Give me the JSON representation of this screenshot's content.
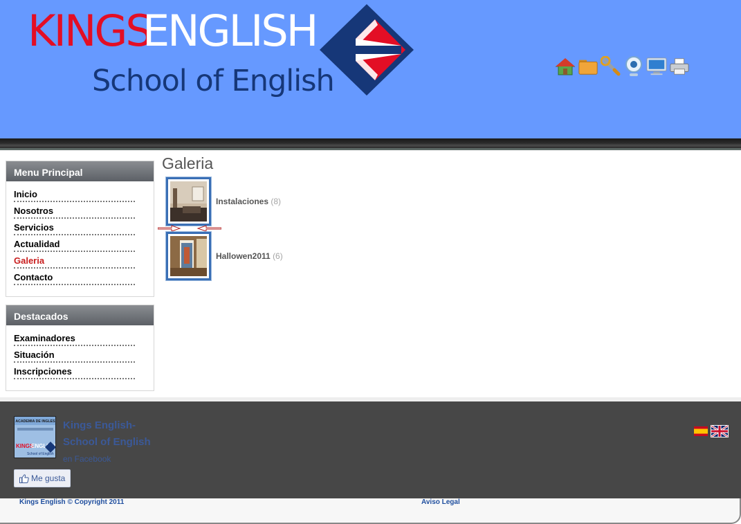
{
  "header": {
    "brand_kings": "KINGS",
    "brand_english": "ENGLISH",
    "brand_subtitle": "School of English",
    "icons": [
      "home-icon",
      "folder-icon",
      "wrench-icon",
      "webcam-icon",
      "monitor-icon",
      "printer-icon"
    ],
    "colors": {
      "header_bg": "#6699ff",
      "brand_red": "#e30e25",
      "brand_navy": "#163778"
    }
  },
  "sidebar": {
    "menu_title": "Menu Principal",
    "menu_items": [
      {
        "label": "Inicio"
      },
      {
        "label": "Nosotros"
      },
      {
        "label": "Servicios"
      },
      {
        "label": "Actualidad"
      },
      {
        "label": "Galeria",
        "active": true
      },
      {
        "label": "Contacto"
      }
    ],
    "featured_title": "Destacados",
    "featured_items": [
      {
        "label": "Examinadores"
      },
      {
        "label": "Situación"
      },
      {
        "label": "Inscripciones"
      }
    ]
  },
  "main": {
    "title": "Galeria",
    "albums": [
      {
        "name": "Instalaciones",
        "count": "(8)"
      },
      {
        "name": "Hallowen2011",
        "count": "(6)"
      }
    ]
  },
  "footer": {
    "facebook": {
      "page_name": "Kings English- School of English",
      "suffix": "en Facebook",
      "like_label": "Me gusta",
      "pic_top": "ACADEMIA DE INGLES",
      "pic_brand_kings": "KINGS",
      "pic_brand_english": "ENGLISH",
      "pic_sub": "School of English"
    },
    "flags": [
      "spain-flag-icon",
      "uk-flag-icon"
    ],
    "copyright": "Kings English © Copyright 2011",
    "legal": "Aviso Legal",
    "colors": {
      "footer_bg": "#474747",
      "facebook_blue": "#3b5998"
    }
  }
}
